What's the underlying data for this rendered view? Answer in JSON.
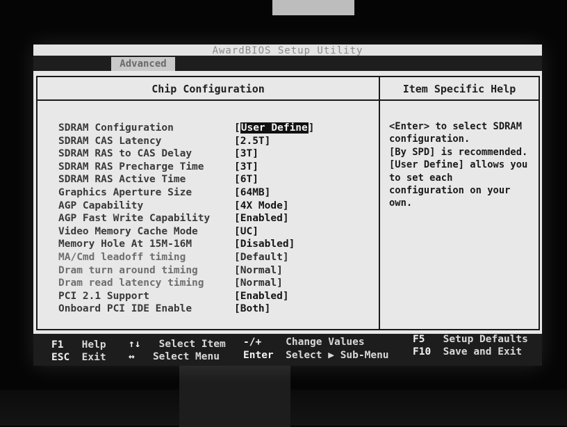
{
  "bios": {
    "title": "AwardBIOS Setup Utility",
    "active_tab": "Advanced",
    "panel_title": "Chip Configuration",
    "help_title": "Item Specific Help",
    "settings": [
      {
        "label": "SDRAM Configuration",
        "value": "User Define",
        "selected": true
      },
      {
        "label": "SDRAM CAS Latency",
        "value": "[2.5T]"
      },
      {
        "label": "SDRAM RAS to CAS Delay",
        "value": "[3T]"
      },
      {
        "label": "SDRAM RAS Precharge Time",
        "value": "[3T]"
      },
      {
        "label": "SDRAM RAS Active Time",
        "value": "[6T]"
      },
      {
        "label": "Graphics Aperture Size",
        "value": "[64MB]"
      },
      {
        "label": "AGP Capability",
        "value": "[4X Mode]"
      },
      {
        "label": "AGP Fast Write Capability",
        "value": "[Enabled]"
      },
      {
        "label": "Video Memory Cache Mode",
        "value": "[UC]"
      },
      {
        "label": "Memory Hole At 15M-16M",
        "value": "[Disabled]"
      },
      {
        "label": "MA/Cmd leadoff timing",
        "value": "[Default]"
      },
      {
        "label": "Dram turn around timing",
        "value": "[Normal]"
      },
      {
        "label": "Dram read latency timing",
        "value": "[Normal]"
      },
      {
        "label": "PCI 2.1 Support",
        "value": "[Enabled]"
      },
      {
        "label": "Onboard PCI IDE Enable",
        "value": "[Both]"
      }
    ],
    "help_lines": [
      "<Enter> to select SDRAM",
      "configuration.",
      "[By SPD] is recommended.",
      "[User Define] allows you",
      "to set each",
      "configuration on your",
      "own."
    ],
    "footer": {
      "f1_key": "F1",
      "f1_desc": "Help",
      "esc_key": "ESC",
      "esc_desc": "Exit",
      "updown_key": "↑↓",
      "updown_desc": "Select Item",
      "leftright_key": "↔",
      "leftright_desc": "Select Menu",
      "plusminus_key": "-/+",
      "plusminus_desc": "Change Values",
      "enter_key": "Enter",
      "enter_desc": "Select ▶ Sub-Menu",
      "f5_key": "F5",
      "f5_desc": "Setup Defaults",
      "f10_key": "F10",
      "f10_desc": "Save and Exit"
    }
  }
}
